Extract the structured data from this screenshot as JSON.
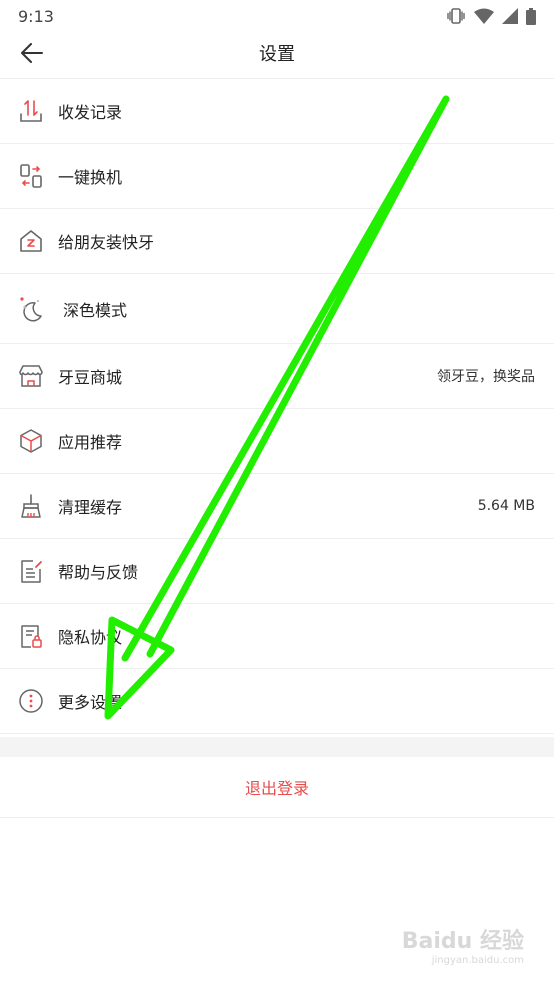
{
  "status_bar": {
    "time": "9:13"
  },
  "header": {
    "title": "设置"
  },
  "menu": [
    {
      "label": "收发记录",
      "value": "",
      "icon": "transfer-record-icon"
    },
    {
      "label": "一键换机",
      "value": "",
      "icon": "phone-switch-icon"
    },
    {
      "label": "给朋友装快牙",
      "value": "",
      "icon": "share-install-icon"
    },
    {
      "label": "深色模式",
      "value": "",
      "icon": "dark-mode-moon-icon"
    },
    {
      "label": "牙豆商城",
      "value": "领牙豆，换奖品",
      "icon": "store-icon"
    },
    {
      "label": "应用推荐",
      "value": "",
      "icon": "cube-icon"
    },
    {
      "label": "清理缓存",
      "value": "5.64 MB",
      "icon": "broom-icon"
    },
    {
      "label": "帮助与反馈",
      "value": "",
      "icon": "feedback-icon"
    },
    {
      "label": "隐私协议",
      "value": "",
      "icon": "privacy-lock-icon"
    },
    {
      "label": "更多设置",
      "value": "",
      "icon": "more-dots-icon"
    }
  ],
  "logout": {
    "label": "退出登录"
  },
  "watermark": {
    "text": "Baidu 经验",
    "sub": "jingyan.baidu.com"
  },
  "colors": {
    "accent": "#e84c4c",
    "icon_gray": "#666666",
    "annotation_arrow": "#22ee00",
    "divider": "#eeeeee",
    "section_bg": "#f4f4f4"
  }
}
